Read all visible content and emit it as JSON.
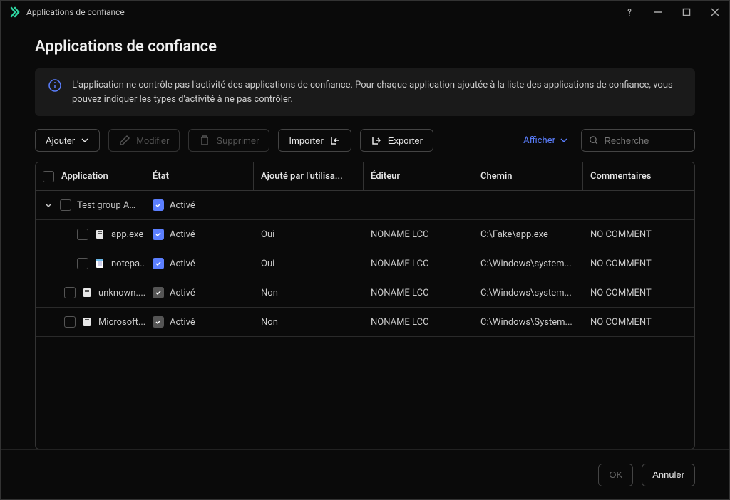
{
  "window": {
    "title": "Applications de confiance"
  },
  "page": {
    "heading": "Applications de confiance",
    "info_text": "L'application ne contrôle pas l'activité des applications de confiance. Pour chaque application ajoutée à la liste des applications de confiance, vous pouvez indiquer les types d'activité à ne pas contrôler."
  },
  "toolbar": {
    "add": "Ajouter",
    "edit": "Modifier",
    "delete": "Supprimer",
    "import": "Importer",
    "export": "Exporter",
    "view": "Afficher",
    "search_placeholder": "Recherche"
  },
  "table": {
    "headers": {
      "app": "Application",
      "state": "État",
      "added_by_user": "Ajouté par l'utilisa...",
      "editor": "Éditeur",
      "path": "Chemin",
      "comments": "Commentaires"
    },
    "group": {
      "name": "Test group App",
      "state_checked": true,
      "state": "Activé"
    },
    "rows": [
      {
        "indent": "deep",
        "icon": "exe",
        "name": "app.exe",
        "state_checked": true,
        "state": "Activé",
        "added": "Oui",
        "editor": "NONAME LCC",
        "path": "C:\\Fake\\app.exe",
        "comment": "NO COMMENT"
      },
      {
        "indent": "deep",
        "icon": "notepad",
        "name": "notepa...",
        "state_checked": true,
        "state": "Activé",
        "added": "Oui",
        "editor": "NONAME LCC",
        "path": "C:\\Windows\\system...",
        "comment": "NO COMMENT"
      },
      {
        "indent": "shallow",
        "icon": "exe",
        "name": "unknown....",
        "state_checked": false,
        "state": "Activé",
        "added": "Non",
        "editor": "NONAME LCC",
        "path": "C:\\Windows\\system...",
        "comment": "NO COMMENT"
      },
      {
        "indent": "shallow",
        "icon": "exe",
        "name": "Microsoft...",
        "state_checked": false,
        "state": "Activé",
        "added": "Non",
        "editor": "NONAME LCC",
        "path": "C:\\Windows\\System...",
        "comment": "NO COMMENT"
      }
    ]
  },
  "footer": {
    "ok": "OK",
    "cancel": "Annuler"
  }
}
